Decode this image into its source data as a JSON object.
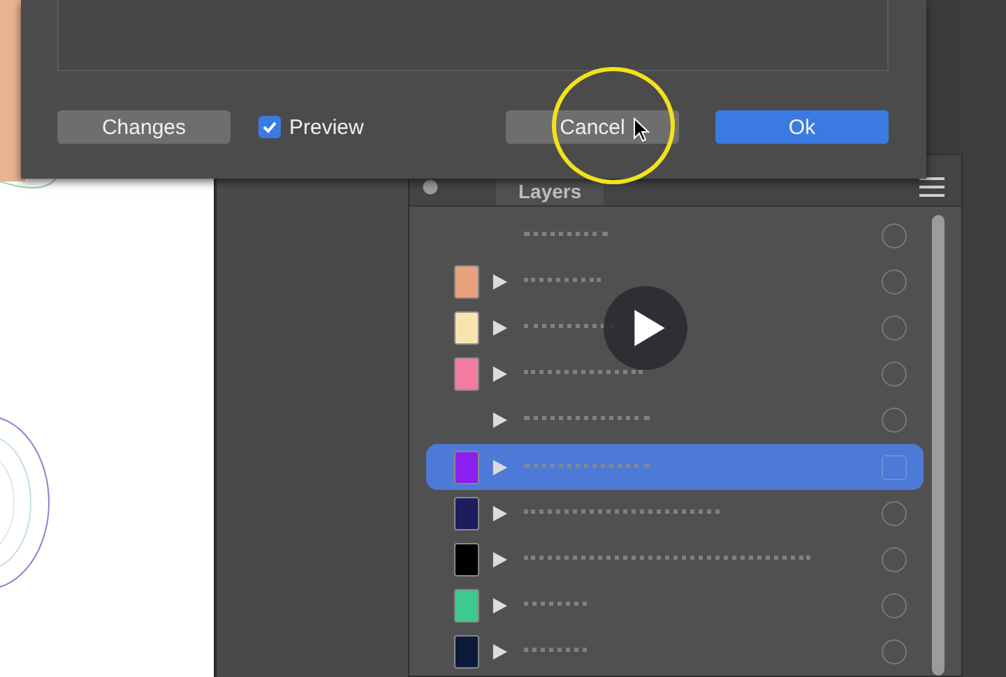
{
  "dialog": {
    "buttons": [
      {
        "label": "Changes",
        "kind": "secondary"
      },
      {
        "label": "Cancel",
        "kind": "secondary"
      },
      {
        "label": "Ok",
        "kind": "primary"
      }
    ],
    "preview": {
      "label": "Preview",
      "checked": true
    }
  },
  "layers_panel": {
    "tab": "Layers",
    "rows": [
      {
        "has_arrow": false,
        "selected": false
      },
      {
        "color": "#e8a17d",
        "has_arrow": true,
        "selected": false
      },
      {
        "color": "#f7e4b0",
        "has_arrow": true,
        "selected": false
      },
      {
        "color": "#f27ca0",
        "has_arrow": true,
        "selected": false
      },
      {
        "has_arrow": true,
        "selected": false
      },
      {
        "color": "#8a1ff0",
        "has_arrow": true,
        "selected": true
      },
      {
        "color": "#1c1c5e",
        "has_arrow": true,
        "selected": false
      },
      {
        "color": "#000000",
        "has_arrow": true,
        "selected": false
      },
      {
        "color": "#3ec98e",
        "has_arrow": true,
        "selected": false
      },
      {
        "color": "#0c1a3a",
        "has_arrow": true,
        "selected": false
      }
    ]
  }
}
